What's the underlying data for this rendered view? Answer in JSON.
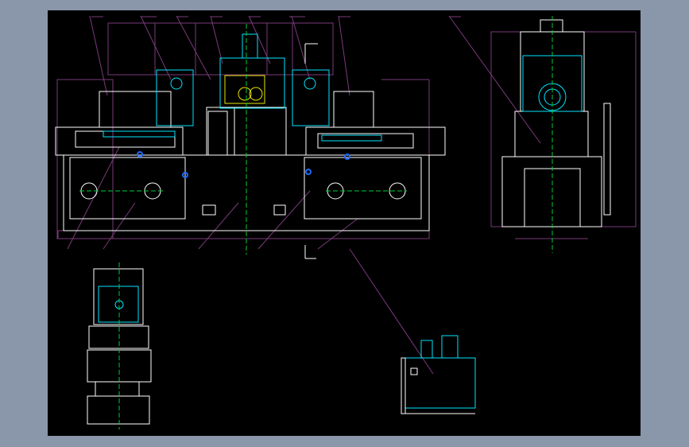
{
  "viewer": {
    "background_color": "#8a97aa",
    "drawing_background": "#000000"
  },
  "drawing": {
    "line_colors": {
      "outline": "#ffffff",
      "component": "#00e5ff",
      "centerline": "#00cc33",
      "dimension": "#7a3a7a",
      "gear": "#e6e600",
      "part": "#1e6bff"
    },
    "views": [
      "front-view",
      "side-view",
      "head-detail-view",
      "hydraulic-unit-view"
    ]
  }
}
